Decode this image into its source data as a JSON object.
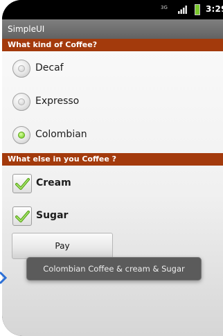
{
  "status_bar": {
    "network_type": "3G",
    "time": "3:29"
  },
  "app": {
    "title": "SimpleUI"
  },
  "coffee_section": {
    "header": "What kind of Coffee?",
    "options": [
      {
        "label": "Decaf",
        "selected": false
      },
      {
        "label": "Expresso",
        "selected": false
      },
      {
        "label": "Colombian",
        "selected": true
      }
    ]
  },
  "extras_section": {
    "header": "What else in you Coffee ?",
    "options": [
      {
        "label": "Cream",
        "checked": true
      },
      {
        "label": "Sugar",
        "checked": true
      }
    ]
  },
  "pay_button": {
    "label": "Pay"
  },
  "toast": {
    "message": "Colombian Coffee  & cream  & Sugar"
  },
  "colors": {
    "section_header": "#a33a0c",
    "title_bar": "#6e6e6e",
    "radio_selected": "#6cc91a",
    "checkmark": "#6cc91a"
  }
}
